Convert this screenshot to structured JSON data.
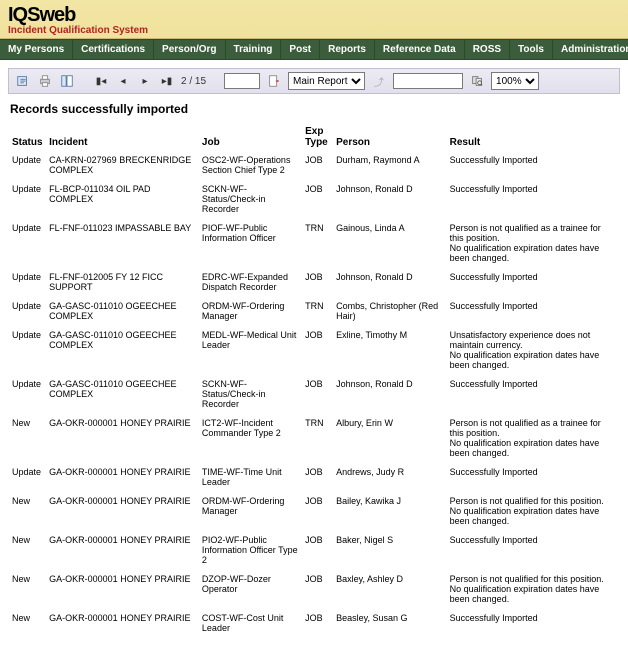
{
  "header": {
    "logo_main": "IQS",
    "logo_sub": "web",
    "tagline": "Incident Qualification System"
  },
  "nav": {
    "items": [
      "My Persons",
      "Certifications",
      "Person/Org",
      "Training",
      "Post",
      "Reports",
      "Reference Data",
      "ROSS",
      "Tools",
      "Administration"
    ]
  },
  "toolbar": {
    "page_indicator": "2 / 15",
    "goto_value": "",
    "main_select": "Main Report",
    "search_value": "",
    "zoom": "100%"
  },
  "content": {
    "title": "Records successfully imported",
    "columns": {
      "status": "Status",
      "incident": "Incident",
      "job": "Job",
      "exp_type": "Exp Type",
      "person": "Person",
      "result": "Result"
    },
    "rows": [
      {
        "status": "Update",
        "incident": "CA-KRN-027969 BRECKENRIDGE COMPLEX",
        "job": "OSC2-WF-Operations Section Chief Type 2",
        "exp": "JOB",
        "person": "Durham, Raymond A",
        "result": "Successfully Imported"
      },
      {
        "status": "Update",
        "incident": "FL-BCP-011034 OIL PAD COMPLEX",
        "job": "SCKN-WF-Status/Check-in Recorder",
        "exp": "JOB",
        "person": "Johnson, Ronald D",
        "result": "Successfully Imported"
      },
      {
        "status": "Update",
        "incident": "FL-FNF-011023 IMPASSABLE BAY",
        "job": "PIOF-WF-Public Information Officer",
        "exp": "TRN",
        "person": "Gainous, Linda A",
        "result": "Person is not qualified as a trainee for this position.\nNo qualification expiration dates have been changed."
      },
      {
        "status": "Update",
        "incident": "FL-FNF-012005 FY 12 FICC SUPPORT",
        "job": "EDRC-WF-Expanded Dispatch Recorder",
        "exp": "JOB",
        "person": "Johnson, Ronald D",
        "result": "Successfully Imported"
      },
      {
        "status": "Update",
        "incident": "GA-GASC-011010 OGEECHEE COMPLEX",
        "job": "ORDM-WF-Ordering Manager",
        "exp": "TRN",
        "person": "Combs, Christopher (Red Hair)",
        "result": "Successfully Imported"
      },
      {
        "status": "Update",
        "incident": "GA-GASC-011010 OGEECHEE COMPLEX",
        "job": "MEDL-WF-Medical Unit Leader",
        "exp": "JOB",
        "person": "Exline, Timothy M",
        "result": "Unsatisfactory experience does not maintain currency.\nNo qualification expiration dates have been changed."
      },
      {
        "status": "Update",
        "incident": "GA-GASC-011010 OGEECHEE COMPLEX",
        "job": "SCKN-WF-Status/Check-in Recorder",
        "exp": "JOB",
        "person": "Johnson, Ronald D",
        "result": "Successfully Imported"
      },
      {
        "status": "New",
        "incident": "GA-OKR-000001 HONEY PRAIRIE",
        "job": "ICT2-WF-Incident Commander Type 2",
        "exp": "TRN",
        "person": "Albury, Erin W",
        "result": "Person is not qualified as a trainee for this position.\nNo qualification expiration dates have been changed."
      },
      {
        "status": "Update",
        "incident": "GA-OKR-000001 HONEY PRAIRIE",
        "job": "TIME-WF-Time Unit Leader",
        "exp": "JOB",
        "person": "Andrews, Judy R",
        "result": "Successfully Imported"
      },
      {
        "status": "New",
        "incident": "GA-OKR-000001 HONEY PRAIRIE",
        "job": "ORDM-WF-Ordering Manager",
        "exp": "JOB",
        "person": "Bailey, Kawika J",
        "result": "Person is not qualified for this position.\nNo qualification expiration dates have been changed."
      },
      {
        "status": "New",
        "incident": "GA-OKR-000001 HONEY PRAIRIE",
        "job": "PIO2-WF-Public Information Officer Type 2",
        "exp": "JOB",
        "person": "Baker, Nigel S",
        "result": "Successfully Imported"
      },
      {
        "status": "New",
        "incident": "GA-OKR-000001 HONEY PRAIRIE",
        "job": "DZOP-WF-Dozer Operator",
        "exp": "JOB",
        "person": "Baxley, Ashley D",
        "result": "Person is not qualified for this position.\nNo qualification expiration dates have been changed."
      },
      {
        "status": "New",
        "incident": "GA-OKR-000001 HONEY PRAIRIE",
        "job": "COST-WF-Cost Unit Leader",
        "exp": "JOB",
        "person": "Beasley, Susan G",
        "result": "Successfully Imported"
      }
    ]
  }
}
